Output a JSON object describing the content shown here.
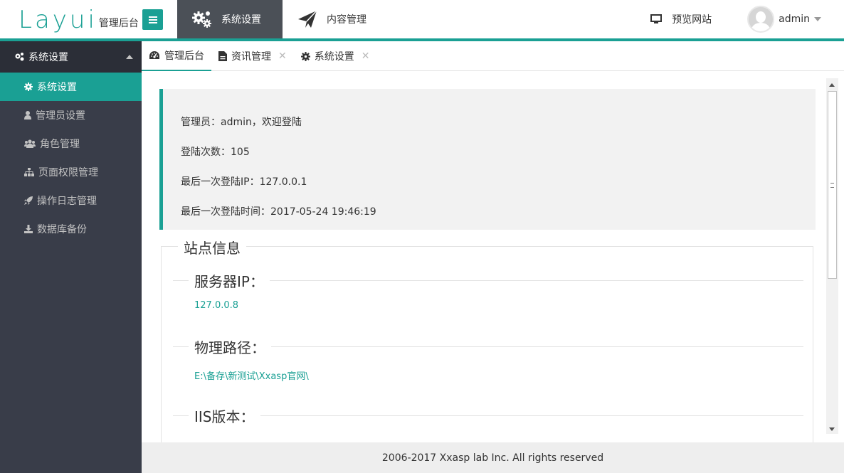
{
  "header": {
    "logo_text": "Layui",
    "logo_sub": "管理后台",
    "nav": [
      {
        "label": "系统设置",
        "icon": "gears-icon",
        "active": true
      },
      {
        "label": "内容管理",
        "icon": "paper-plane-icon",
        "active": false
      }
    ],
    "preview_label": "预览网站",
    "user_name": "admin"
  },
  "sidebar": {
    "group_label": "系统设置",
    "items": [
      {
        "label": "系统设置",
        "icon": "gear-icon"
      },
      {
        "label": "管理员设置",
        "icon": "user-icon"
      },
      {
        "label": "角色管理",
        "icon": "users-icon"
      },
      {
        "label": "页面权限管理",
        "icon": "sitemap-icon"
      },
      {
        "label": "操作日志管理",
        "icon": "rocket-icon"
      },
      {
        "label": "数据库备份",
        "icon": "download-icon"
      }
    ]
  },
  "tabs": [
    {
      "label": "管理后台",
      "icon": "dashboard-icon",
      "closable": false
    },
    {
      "label": "资讯管理",
      "icon": "file-icon",
      "closable": true
    },
    {
      "label": "系统设置",
      "icon": "gear-icon",
      "closable": true
    }
  ],
  "welcome": {
    "line1": "管理员：admin，欢迎登陆",
    "line2": "登陆次数：105",
    "line3": "最后一次登陆IP：127.0.0.1",
    "line4": "最后一次登陆时间：2017-05-24 19:46:19"
  },
  "site_info": {
    "title": "站点信息",
    "server_ip_label": "服务器IP：",
    "server_ip_value": "127.0.0.8",
    "path_label": "物理路径：",
    "path_value": "E:\\备存\\新测试\\Xxasp官网\\",
    "iis_label": "IIS版本："
  },
  "footer": {
    "text": "2006-2017 Xxasp lab Inc. All rights reserved"
  },
  "colors": {
    "accent": "#1aa094",
    "sidebar_bg": "#393d49",
    "sidebar_group_bg": "#2b2e37",
    "topnav_active_bg": "#4b5057"
  }
}
